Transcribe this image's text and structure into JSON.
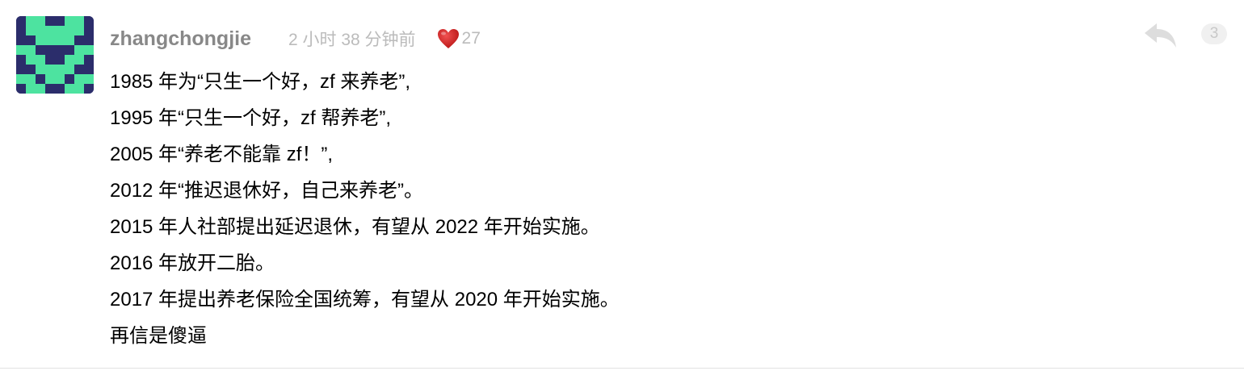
{
  "reply": {
    "username": "zhangchongjie",
    "timestamp": "2 小时 38 分钟前",
    "thanks_count": "27",
    "floor_number": "3",
    "content_lines": [
      "1985 年为“只生一个好，zf 来养老”,",
      "1995 年“只生一个好，zf 帮养老”,",
      "2005 年“养老不能靠 zf！”,",
      "2012 年“推迟退休好，自己来养老”。",
      "2015 年人社部提出延迟退休，有望从 2022 年开始实施。",
      "2016 年放开二胎。",
      "2017 年提出养老保险全国统筹，有望从 2020 年开始实施。",
      "再信是傻逼"
    ]
  },
  "icons": {
    "avatar": "pixel-identicon",
    "thanks": "heart-icon",
    "reply": "reply-arrow-icon"
  },
  "colors": {
    "avatar_background": "#2b2d6b",
    "avatar_pattern": "#4de3a0",
    "heart": "#d22020",
    "meta_text": "#bbbbbb",
    "username": "#888888"
  }
}
